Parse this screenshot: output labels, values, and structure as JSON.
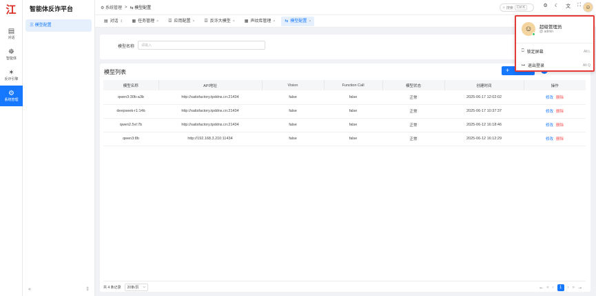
{
  "rail": {
    "logo": "江",
    "items": [
      {
        "icon": "▤",
        "label": "对话"
      },
      {
        "icon": "☸",
        "label": "智能体"
      },
      {
        "icon": "✶",
        "label": "反诈引擎"
      },
      {
        "icon": "⚙",
        "label": "系统管理"
      }
    ]
  },
  "sidebar": {
    "title": "智能体反诈平台",
    "item": "三 模型配置",
    "collapse": "«",
    "pin": "‡"
  },
  "topbar": {
    "breadcrumb": [
      "⚙ 系统管理",
      "⇆ 模型配置"
    ],
    "search_label": "搜索",
    "search_kbd": "Ctrl K",
    "tools": [
      "⚙",
      "☾",
      "文",
      "⛶"
    ],
    "avatar": "☺"
  },
  "tabs": [
    {
      "icon": "▤",
      "label": "对话",
      "close": "‡"
    },
    {
      "icon": "▦",
      "label": "任务管理",
      "close": "×"
    },
    {
      "icon": "☲",
      "label": "应用配置",
      "close": "×"
    },
    {
      "icon": "☲",
      "label": "反诈大模型",
      "close": "×"
    },
    {
      "icon": "▦",
      "label": "声纹库管理",
      "close": "×"
    },
    {
      "icon": "⇆",
      "label": "模型配置",
      "close": "×"
    }
  ],
  "filter": {
    "label": "模型名称",
    "placeholder": "请输入"
  },
  "panel": {
    "title": "模型列表",
    "add": "+"
  },
  "table": {
    "headers": [
      "模型名称",
      "API地址",
      "Vision",
      "Function Call",
      "模型状态",
      "创建时间",
      "操作"
    ],
    "rows": [
      [
        "qwen3:30b-a3b",
        "http://satisfactory.tpddns.cn:21434",
        "false",
        "false",
        "正常",
        "2025-06-17 12:02:02"
      ],
      [
        "deepseek-r1:14b",
        "http://satisfactory.tpddns.cn:21434",
        "false",
        "false",
        "正常",
        "2025-06-17 10:37:37"
      ],
      [
        "qwen2.5vl:7b",
        "http://satisfactory.tpddns.cn:21434",
        "false",
        "false",
        "正常",
        "2025-06-12 16:18:46"
      ],
      [
        "qwen3:8b",
        "http://192.168.3.210:11434",
        "false",
        "false",
        "正常",
        "2025-06-12 16:12:29"
      ]
    ],
    "edit": "修改",
    "delete": "删除"
  },
  "footer": {
    "total": "共 4 条记录",
    "page_size": "20条/页",
    "page_size_arrow": "⌵",
    "current_page": "1",
    "pager_prev": [
      "«",
      "‹"
    ],
    "pager_next": [
      "›",
      "»"
    ],
    "pager_first": "⇤",
    "pager_last": "⇥"
  },
  "popup": {
    "avatar": "☺",
    "name": "超级管理员",
    "username": "@ admin",
    "lock_icon": "⎕",
    "lock_label": "锁定屏幕",
    "lock_shortcut": "Alt L",
    "logout_icon": "↦",
    "logout_label": "退出登录",
    "logout_shortcut": "Alt Q"
  }
}
